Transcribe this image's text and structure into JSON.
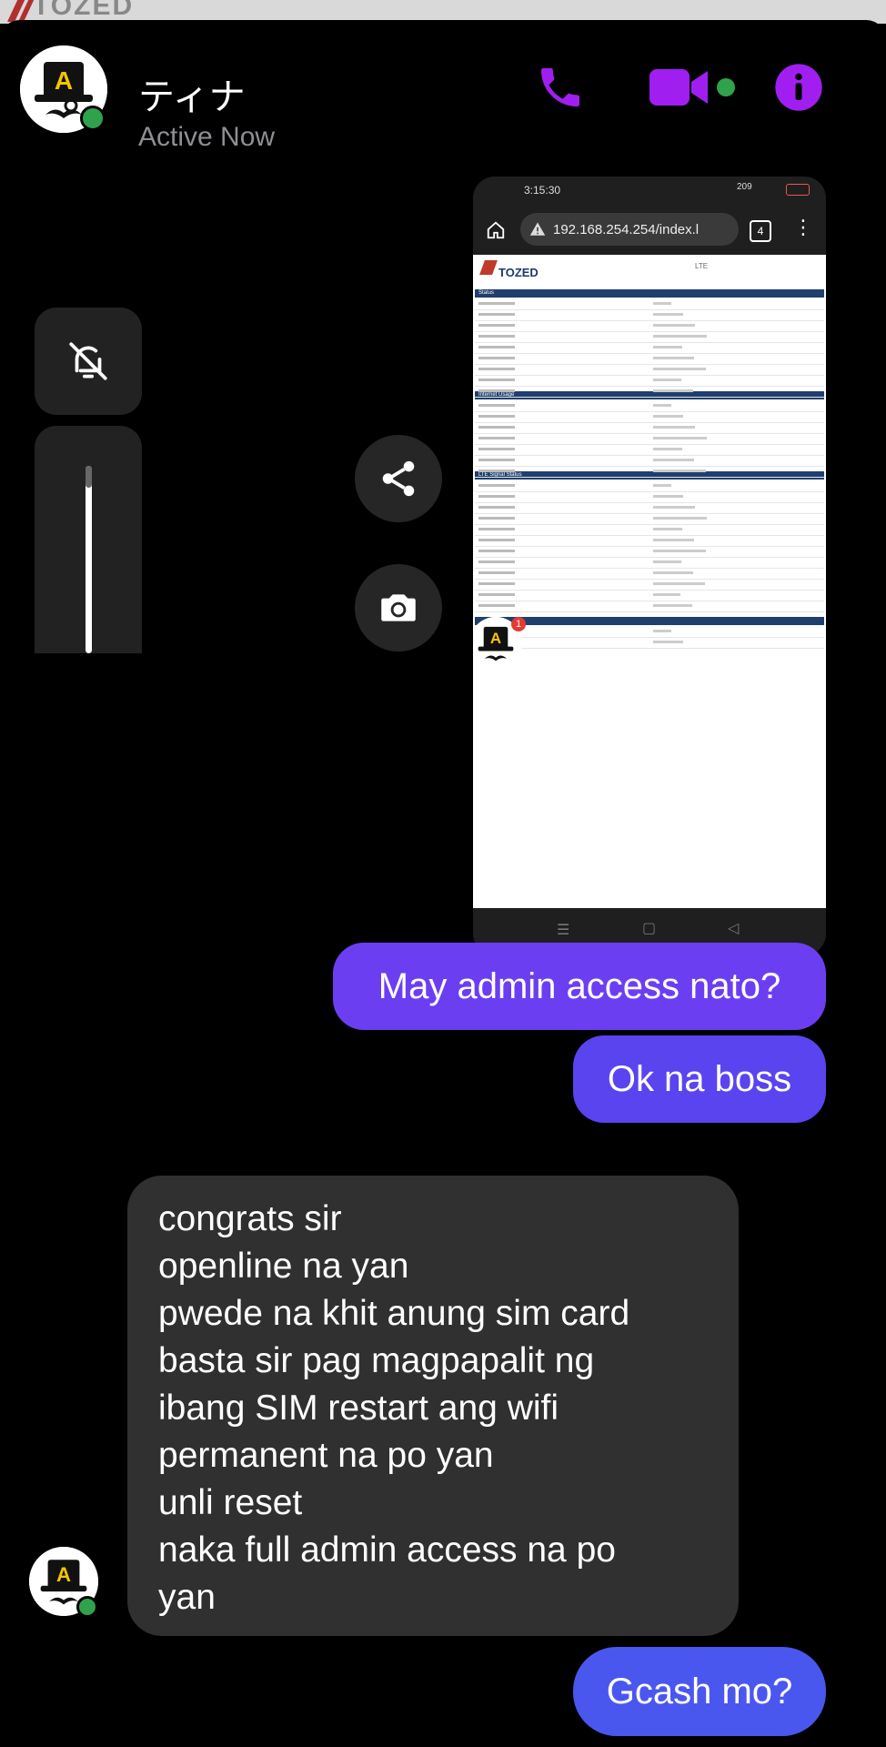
{
  "behind": {
    "logo_text": "TOZED"
  },
  "header": {
    "contact_name": "ティナ",
    "status": "Active Now",
    "accent": "#a01ff0",
    "online_color": "#31a24c"
  },
  "icons": {
    "call": "phone-icon",
    "video": "video-camera-icon",
    "info": "info-icon",
    "mute": "bell-off-icon",
    "share": "share-icon",
    "camera": "camera-icon"
  },
  "screenshot": {
    "time": "3:15:30",
    "url": "192.168.254.254/index.l",
    "tab_count": "4",
    "status_right": "209",
    "page_brand": "TOZED",
    "page_brand_right": "LTE",
    "avatar_badge": "1",
    "sections": [
      "Status",
      "Internet Usage",
      "LTE Signal Status"
    ]
  },
  "messages": {
    "sent1": "May admin access nato?",
    "sent2": "Ok na boss",
    "received_lines": [
      "congrats sir",
      "openline na yan",
      "pwede na khit anung sim card",
      "basta sir pag magpapalit ng",
      "ibang SIM restart ang wifi",
      "permanent na po yan",
      "unli reset",
      "naka full admin access na po",
      "yan"
    ],
    "sent3": "Gcash mo?"
  }
}
